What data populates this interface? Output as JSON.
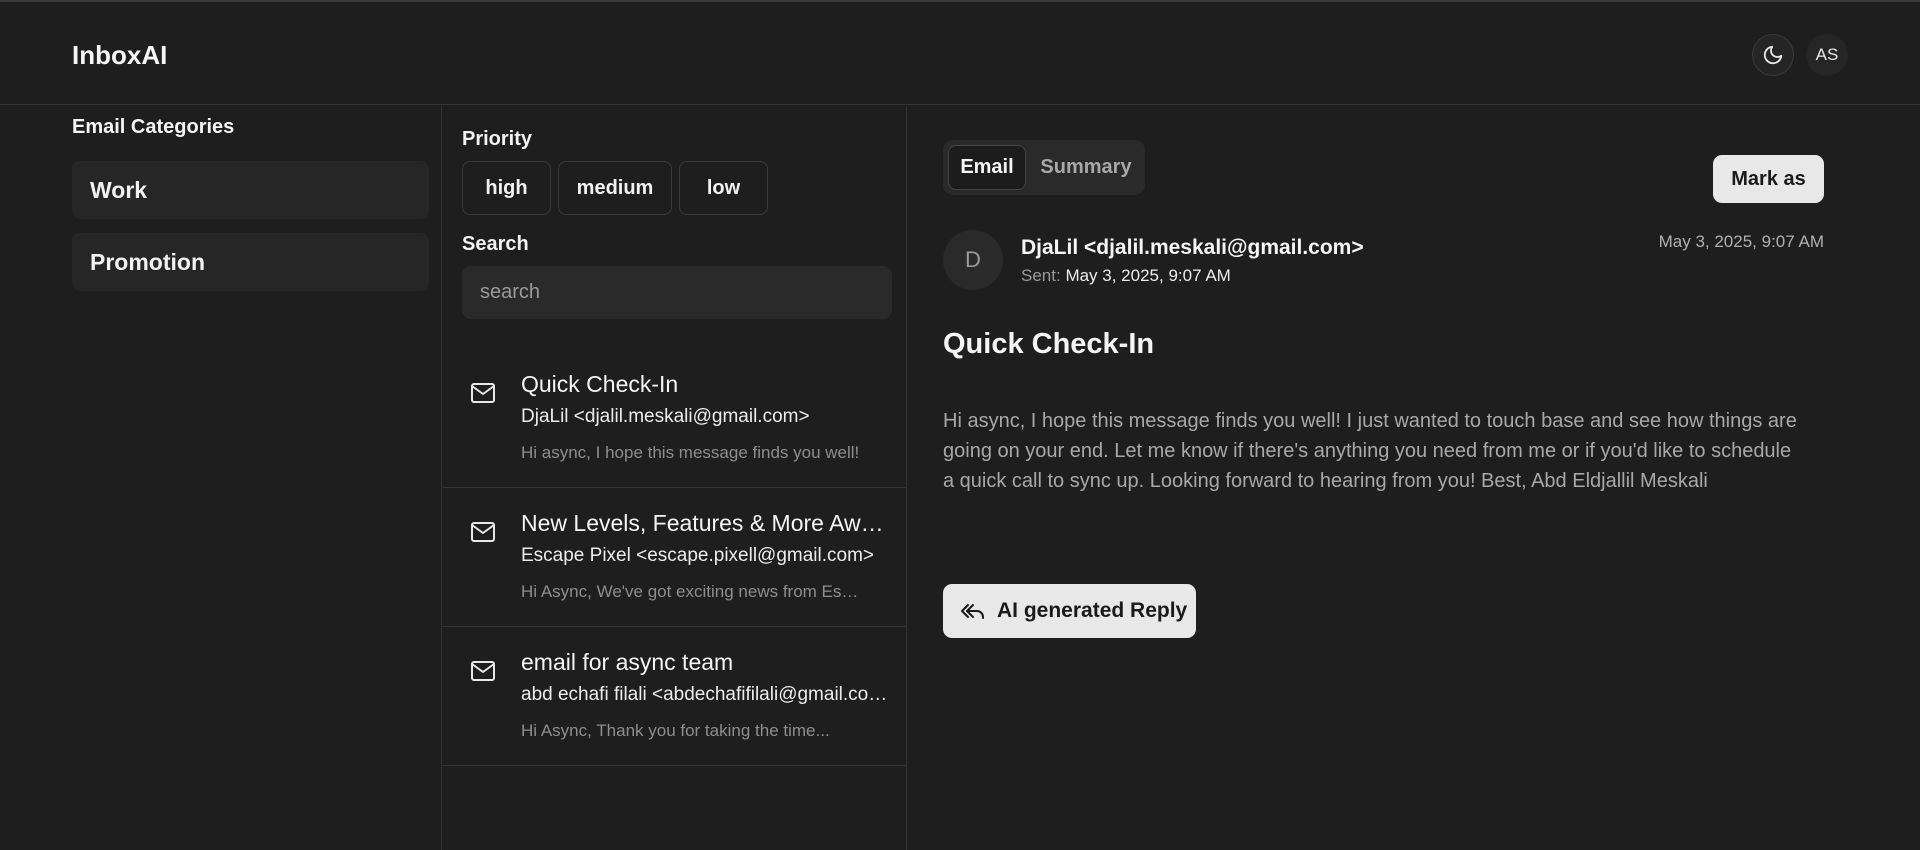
{
  "app": {
    "brand": "InboxAI",
    "user_initials": "AS",
    "theme_icon": "moon-icon"
  },
  "sidebar": {
    "title": "Email Categories",
    "items": [
      {
        "label": "Work"
      },
      {
        "label": "Promotion"
      }
    ]
  },
  "filters": {
    "priority_label": "Priority",
    "priorities": [
      "high",
      "medium",
      "low"
    ],
    "search_label": "Search",
    "search_placeholder": "search"
  },
  "emails": [
    {
      "subject": "Quick Check-In",
      "from": "DjaLil <djalil.meskali@gmail.com>",
      "preview": "Hi async, I hope this message finds you well!"
    },
    {
      "subject": "New Levels, Features & More Await You!",
      "from": "Escape Pixel <escape.pixell@gmail.com>",
      "preview": "Hi Async, We've got exciting news from Escape Pixel"
    },
    {
      "subject": "email for async team",
      "from": "abd echafi filali <abdechafifilali@gmail.com>",
      "preview": "Hi Async, Thank you for taking the time..."
    }
  ],
  "detail": {
    "tabs": [
      "Email",
      "Summary"
    ],
    "mark_as_label": "Mark as",
    "avatar_letter": "D",
    "sender": "DjaLil <djalil.meskali@gmail.com>",
    "sent_label": "Sent:",
    "sent_value": "May 3, 2025, 9:07 AM",
    "date": "May 3, 2025, 9:07 AM",
    "title": "Quick Check-In",
    "body": "Hi async, I hope this message finds you well! I just wanted to touch base and see how things are going on your end. Let me know if there's anything you need from me or if you'd like to schedule a quick call to sync up. Looking forward to hearing from you! Best, Abd Eldjallil Meskali",
    "ai_reply_label": "AI generated Reply"
  }
}
